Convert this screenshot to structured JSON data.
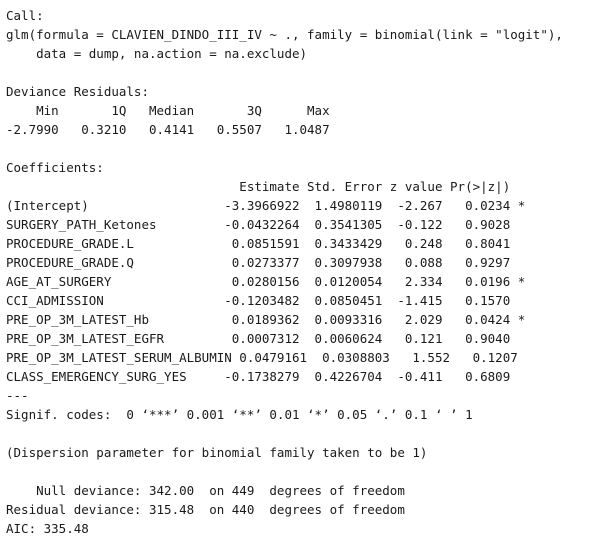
{
  "output_lines": [
    "Call:",
    "glm(formula = CLAVIEN_DINDO_III_IV ~ ., family = binomial(link = \"logit\"),",
    "    data = dump, na.action = na.exclude)",
    "",
    "Deviance Residuals:",
    "    Min       1Q   Median       3Q      Max  ",
    "-2.7990   0.3210   0.4141   0.5507   1.0487  ",
    "",
    "Coefficients:",
    "                               Estimate Std. Error z value Pr(>|z|)  ",
    "(Intercept)                  -3.3966922  1.4980119  -2.267   0.0234 *",
    "SURGERY_PATH_Ketones         -0.0432264  0.3541305  -0.122   0.9028  ",
    "PROCEDURE_GRADE.L             0.0851591  0.3433429   0.248   0.8041  ",
    "PROCEDURE_GRADE.Q             0.0273377  0.3097938   0.088   0.9297  ",
    "AGE_AT_SURGERY                0.0280156  0.0120054   2.334   0.0196 *",
    "CCI_ADMISSION                -0.1203482  0.0850451  -1.415   0.1570  ",
    "PRE_OP_3M_LATEST_Hb           0.0189362  0.0093316   2.029   0.0424 *",
    "PRE_OP_3M_LATEST_EGFR         0.0007312  0.0060624   0.121   0.9040  ",
    "PRE_OP_3M_LATEST_SERUM_ALBUMIN 0.0479161  0.0308803   1.552   0.1207  ",
    "CLASS_EMERGENCY_SURG_YES     -0.1738279  0.4226704  -0.411   0.6809  ",
    "---",
    "Signif. codes:  0 ‘***’ 0.001 ‘**’ 0.01 ‘*’ 0.05 ‘.’ 0.1 ‘ ’ 1",
    "",
    "(Dispersion parameter for binomial family taken to be 1)",
    "",
    "    Null deviance: 342.00  on 449  degrees of freedom",
    "Residual deviance: 315.48  on 440  degrees of freedom",
    "AIC: 335.48"
  ]
}
